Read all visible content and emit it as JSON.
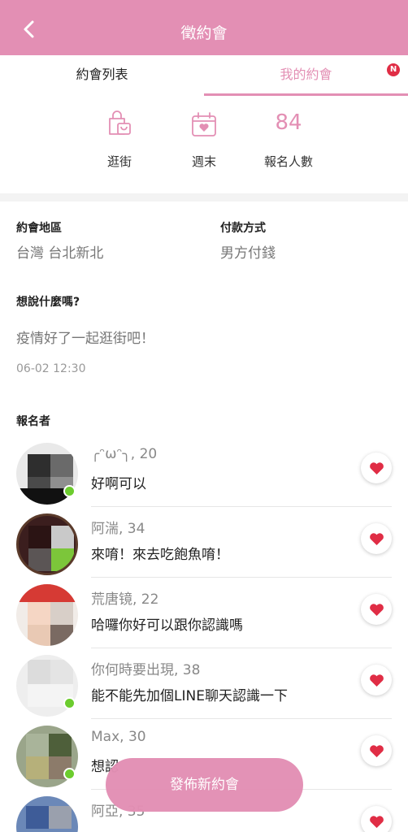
{
  "header": {
    "title": "徵約會",
    "back_icon": "chevron-left-icon"
  },
  "tabs": [
    {
      "label": "約會列表",
      "active": false
    },
    {
      "label": "我的約會",
      "active": true
    }
  ],
  "tab_badge": "N",
  "colors": {
    "accent": "#e38fb4",
    "heart": "#e02d45",
    "online": "#6ccc2e"
  },
  "stats": [
    {
      "icon": "shopping-bag-icon",
      "label": "逛街"
    },
    {
      "icon": "calendar-heart-icon",
      "label": "週末"
    },
    {
      "value": "84",
      "label": "報名人數"
    }
  ],
  "info": {
    "region_label": "約會地區",
    "region_value": "台灣 台北新北",
    "payment_label": "付款方式",
    "payment_value": "男方付錢",
    "message_label": "想說什麼嗎?",
    "message_value": "疫情好了一起逛街吧！",
    "timestamp": "06-02 12:30"
  },
  "applicants_label": "報名者",
  "applicants": [
    {
      "name": "╭ᵔωᵔ╮, 20",
      "message": "好啊可以",
      "online": true
    },
    {
      "name": "阿湍, 34",
      "message": "來唷！來去吃飽魚唷！",
      "online": false
    },
    {
      "name": "荒唐镜, 22",
      "message": "哈囉你好可以跟你認識嗎",
      "online": false
    },
    {
      "name": "你何時要出現, 38",
      "message": "能不能先加個LINE聊天認識一下",
      "online": true
    },
    {
      "name": "Max, 30",
      "message": "想認",
      "online": true
    },
    {
      "name": "阿亞, 35",
      "message": "",
      "online": false
    }
  ],
  "fab_label": "發佈新約會"
}
